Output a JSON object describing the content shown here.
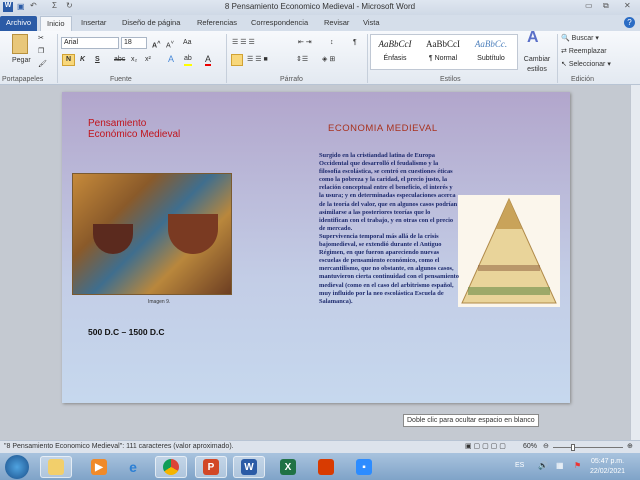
{
  "window": {
    "title": "8 Pensamiento Economico Medieval - Microsoft Word"
  },
  "tabs": [
    "Archivo",
    "Inicio",
    "Insertar",
    "Diseño de página",
    "Referencias",
    "Correspondencia",
    "Revisar",
    "Vista"
  ],
  "ribbon": {
    "clipboard": {
      "paste": "Pegar",
      "group": "Portapapeles"
    },
    "font": {
      "name": "Arial",
      "size": "18",
      "group": "Fuente",
      "bold": "N",
      "italic": "K",
      "underline": "S",
      "sub": "x₂",
      "sup": "x²",
      "case": "Aa"
    },
    "paragraph": {
      "group": "Párrafo"
    },
    "styles": {
      "group": "Estilos",
      "items": [
        {
          "sample": "AaBbCcI",
          "label": "Énfasis"
        },
        {
          "sample": "AaBbCcI",
          "label": "¶ Normal"
        },
        {
          "sample": "AaBbCc.",
          "label": "Subtítulo"
        }
      ],
      "change": "Cambiar estilos"
    },
    "editing": {
      "group": "Edición",
      "find": "Buscar",
      "replace": "Reemplazar",
      "select": "Seleccionar"
    }
  },
  "document": {
    "left_title_1": "Pensamiento",
    "left_title_2": "Económico Medieval",
    "heading": "ECONOMIA  MEDIEVAL",
    "caption": "Imagen 9.",
    "period": "500 D.C – 1500 D.C",
    "body": "Surgido en la cristiandad latina de Europa Occidental que desarrolló el feudalismo y la filosofía escolástica, se centró en cuestiones éticas como la pobreza y la caridad, el precio justo, la relación conceptual entre el beneficio, el interés y la usura; y en determinadas especulaciones acerca de la teoría del valor, que en algunos casos podrían asimilarse a las posteriores teorías que lo identifican con el trabajo, y en otras con el precio de mercado.\nSupervivencia temporal más allá de la crisis bajomedieval, se extendió durante el Antiguo Régimen, en que fueron apareciendo nuevas escuelas de pensamiento económico, como el mercantilismo, que no obstante, en algunos casos, mantuvieron cierta continuidad con el pensamiento medieval (como en el caso del arbitrismo español, muy influido por la neo escolástica Escuela de Salamanca).",
    "tooltip": "Doble clic para ocultar espacio en blanco"
  },
  "status": {
    "text": "\"8 Pensamiento Economico Medieval\": 111 caracteres (valor aproximado).",
    "zoom": "60%",
    "zoom_fraction": 0.6
  },
  "taskbar": {
    "lang": "ES",
    "time": "05:47 p.m.",
    "date": "22/02/2021"
  },
  "colors": {
    "accent": "#2b5ba6",
    "title_red": "#c0141c",
    "heading": "#a8321e"
  }
}
